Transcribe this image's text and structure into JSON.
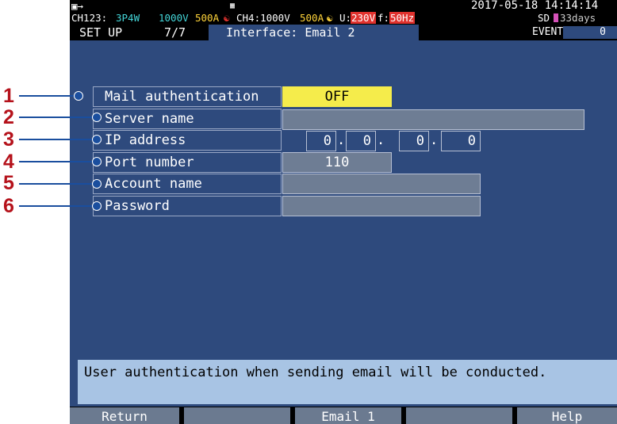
{
  "status": {
    "battery_icon": "battery-plug-icon",
    "sd_icon": "sd-card-icon",
    "sd_label": "SD",
    "datetime": "2017-05-18 14:14:14",
    "ch123": "CH123:",
    "wiring": "3P4W",
    "ch123_volt": "1000V",
    "ch123_amp": "500A",
    "ch4": "CH4:1000V",
    "ch4_amp": "500A",
    "u_label": "U:",
    "u_value": "230V",
    "f_label": "f:",
    "f_value": "50Hz",
    "sd_status": "SD",
    "sd_days": "33days",
    "event_label": "EVENT",
    "event_count": "0"
  },
  "header": {
    "section": "SET UP",
    "page": "7/7",
    "title": "Interface: Email 2"
  },
  "form": {
    "mail_auth_label": "Mail authentication",
    "mail_auth_value": "OFF",
    "server_label": "Server name",
    "server_value": "",
    "ip_label": "IP address",
    "ip": [
      "0",
      "0",
      "0",
      "0"
    ],
    "port_label": "Port number",
    "port_value": "110",
    "account_label": "Account name",
    "account_value": "",
    "password_label": "Password",
    "password_value": ""
  },
  "help_text": "User authentication when sending email will be conducted.",
  "fkeys": [
    "Return",
    "",
    "Email 1",
    "",
    "Help"
  ],
  "callouts": [
    "1",
    "2",
    "3",
    "4",
    "5",
    "6"
  ],
  "colors": {
    "background": "#2e4a7d",
    "highlight": "#f5ec4b",
    "field": "#6e7d94",
    "help_panel": "#a8c4e4",
    "callout_number": "#b5121b",
    "callout_line": "#1a4e9e"
  }
}
